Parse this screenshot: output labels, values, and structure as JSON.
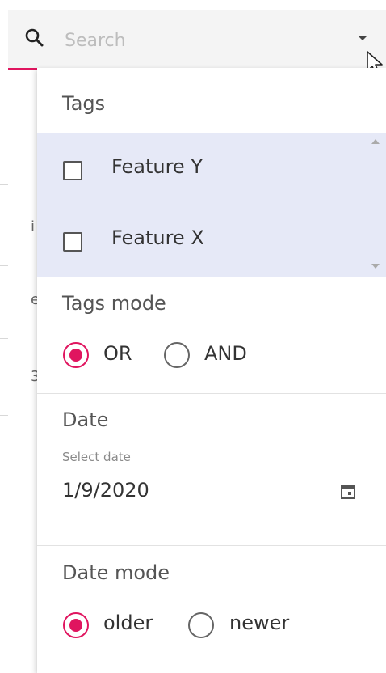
{
  "search": {
    "placeholder": "Search",
    "value": ""
  },
  "background": {
    "chars": [
      "i",
      "e",
      "3"
    ]
  },
  "panel": {
    "tags": {
      "title": "Tags",
      "items": [
        {
          "label": "Feature Y",
          "checked": true
        },
        {
          "label": "Feature X",
          "checked": false
        }
      ]
    },
    "tags_mode": {
      "title": "Tags mode",
      "options": [
        {
          "label": "OR",
          "selected": true
        },
        {
          "label": "AND",
          "selected": false
        }
      ]
    },
    "date": {
      "title": "Date",
      "caption": "Select date",
      "value": "1/9/2020"
    },
    "date_mode": {
      "title": "Date mode",
      "options": [
        {
          "label": "older",
          "selected": true
        },
        {
          "label": "newer",
          "selected": false
        }
      ]
    }
  },
  "colors": {
    "accent": "#e0155f",
    "tags_bg": "#e6e9f7"
  },
  "icons": [
    "search-icon",
    "dropdown-arrow-icon",
    "calendar-icon",
    "checkmark-icon"
  ]
}
